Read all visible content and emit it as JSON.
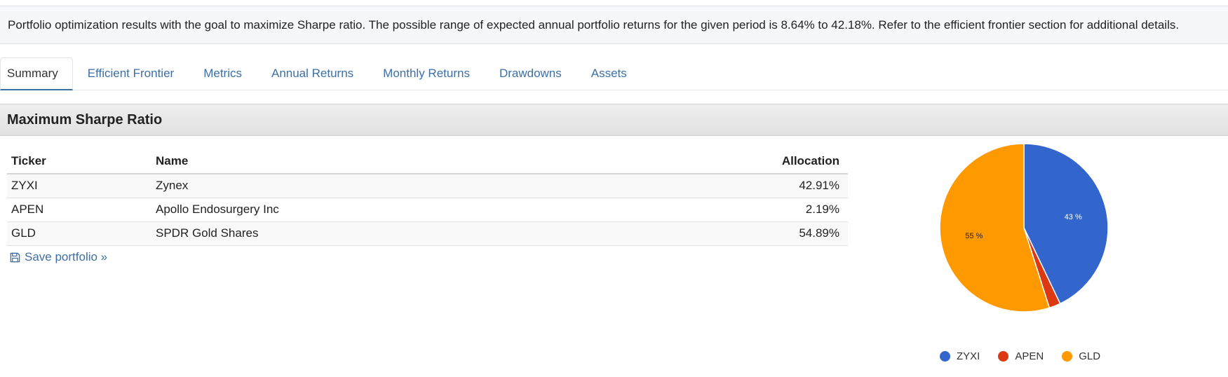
{
  "intro": {
    "text": "Portfolio optimization results with the goal to maximize Sharpe ratio. The possible range of expected annual portfolio returns for the given period is 8.64% to 42.18%. Refer to the efficient frontier section for additional details."
  },
  "tabs": [
    {
      "label": "Summary",
      "active": true
    },
    {
      "label": "Efficient Frontier"
    },
    {
      "label": "Metrics"
    },
    {
      "label": "Annual Returns"
    },
    {
      "label": "Monthly Returns"
    },
    {
      "label": "Drawdowns"
    },
    {
      "label": "Assets"
    }
  ],
  "section": {
    "title": "Maximum Sharpe Ratio"
  },
  "table": {
    "headers": {
      "ticker": "Ticker",
      "name": "Name",
      "allocation": "Allocation"
    },
    "rows": [
      {
        "ticker": "ZYXI",
        "name": "Zynex",
        "allocation": "42.91%"
      },
      {
        "ticker": "APEN",
        "name": "Apollo Endosurgery Inc",
        "allocation": "2.19%"
      },
      {
        "ticker": "GLD",
        "name": "SPDR Gold Shares",
        "allocation": "54.89%"
      }
    ]
  },
  "save_link": {
    "label": "Save portfolio »",
    "icon": "save-icon"
  },
  "chart_data": {
    "type": "pie",
    "categories": [
      "ZYXI",
      "APEN",
      "GLD"
    ],
    "values": [
      42.91,
      2.19,
      54.89
    ],
    "slice_labels": [
      "43 %",
      "",
      "55 %"
    ],
    "colors": [
      "#3366cc",
      "#dc3912",
      "#ff9900"
    ],
    "legend": "bottom"
  }
}
